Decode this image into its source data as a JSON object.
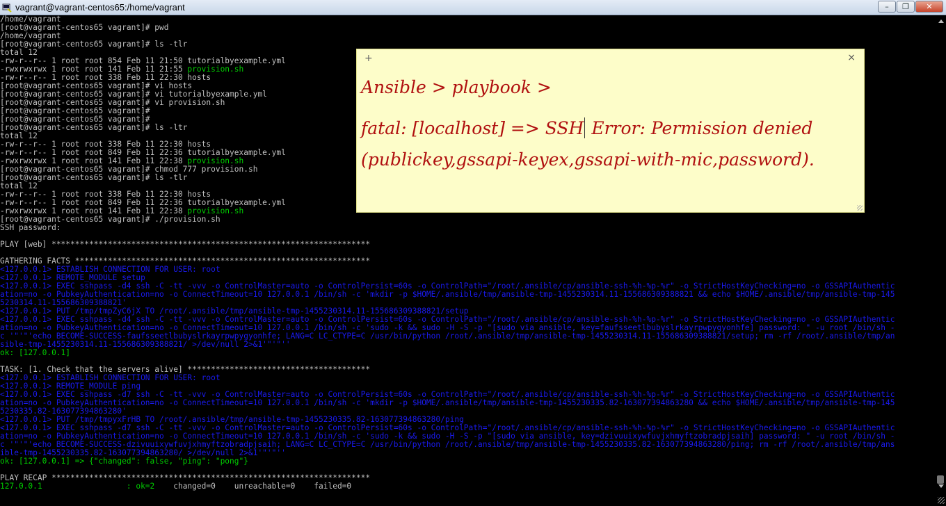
{
  "window": {
    "title": "vagrant@vagrant-centos65:/home/vagrant",
    "minimize": "–",
    "maximize": "❐",
    "close": "✕"
  },
  "terminal_lines": [
    {
      "t": "/home/vagrant",
      "c": "gray"
    },
    {
      "t": "[root@vagrant-centos65 vagrant]# pwd",
      "c": "gray"
    },
    {
      "t": "/home/vagrant",
      "c": "gray"
    },
    {
      "t": "[root@vagrant-centos65 vagrant]# ls -tlr",
      "c": "gray"
    },
    {
      "t": "total 12",
      "c": "gray"
    },
    {
      "t": "-rw-r--r-- 1 root root 854 Feb 11 21:50 tutorialbyexample.yml",
      "c": "gray"
    },
    {
      "t": "-rwxrwxrwx 1 root root 141 Feb 11 21:55 ",
      "c": "gray",
      "g": "provision.sh"
    },
    {
      "t": "-rw-r--r-- 1 root root 338 Feb 11 22:30 hosts",
      "c": "gray"
    },
    {
      "t": "[root@vagrant-centos65 vagrant]# vi hosts",
      "c": "gray"
    },
    {
      "t": "[root@vagrant-centos65 vagrant]# vi tutorialbyexample.yml",
      "c": "gray"
    },
    {
      "t": "[root@vagrant-centos65 vagrant]# vi provision.sh",
      "c": "gray"
    },
    {
      "t": "[root@vagrant-centos65 vagrant]#",
      "c": "gray"
    },
    {
      "t": "[root@vagrant-centos65 vagrant]#",
      "c": "gray"
    },
    {
      "t": "[root@vagrant-centos65 vagrant]# ls -ltr",
      "c": "gray"
    },
    {
      "t": "total 12",
      "c": "gray"
    },
    {
      "t": "-rw-r--r-- 1 root root 338 Feb 11 22:30 hosts",
      "c": "gray"
    },
    {
      "t": "-rw-r--r-- 1 root root 849 Feb 11 22:36 tutorialbyexample.yml",
      "c": "gray"
    },
    {
      "t": "-rwxrwxrwx 1 root root 141 Feb 11 22:38 ",
      "c": "gray",
      "g": "provision.sh"
    },
    {
      "t": "[root@vagrant-centos65 vagrant]# chmod 777 provision.sh",
      "c": "gray"
    },
    {
      "t": "[root@vagrant-centos65 vagrant]# ls -tlr",
      "c": "gray"
    },
    {
      "t": "total 12",
      "c": "gray"
    },
    {
      "t": "-rw-r--r-- 1 root root 338 Feb 11 22:30 hosts",
      "c": "gray"
    },
    {
      "t": "-rw-r--r-- 1 root root 849 Feb 11 22:36 tutorialbyexample.yml",
      "c": "gray"
    },
    {
      "t": "-rwxrwxrwx 1 root root 141 Feb 11 22:38 ",
      "c": "gray",
      "g": "provision.sh"
    },
    {
      "t": "[root@vagrant-centos65 vagrant]# ./provision.sh",
      "c": "gray"
    },
    {
      "t": "SSH password:",
      "c": "gray"
    },
    {
      "t": "",
      "c": "gray"
    },
    {
      "t": "PLAY [web] ********************************************************************",
      "c": "gray"
    },
    {
      "t": "",
      "c": "gray"
    },
    {
      "t": "GATHERING FACTS ***************************************************************",
      "c": "gray"
    },
    {
      "t": "<127.0.0.1> ESTABLISH CONNECTION FOR USER: root",
      "c": "blue"
    },
    {
      "t": "<127.0.0.1> REMOTE_MODULE setup",
      "c": "blue"
    },
    {
      "t": "<127.0.0.1> EXEC sshpass -d4 ssh -C -tt -vvv -o ControlMaster=auto -o ControlPersist=60s -o ControlPath=\"/root/.ansible/cp/ansible-ssh-%h-%p-%r\" -o StrictHostKeyChecking=no -o GSSAPIAuthentic",
      "c": "blue"
    },
    {
      "t": "ation=no -o PubkeyAuthentication=no -o ConnectTimeout=10 127.0.0.1 /bin/sh -c 'mkdir -p $HOME/.ansible/tmp/ansible-tmp-1455230314.11-155686309388821 && echo $HOME/.ansible/tmp/ansible-tmp-145",
      "c": "blue"
    },
    {
      "t": "5230314.11-155686309388821'",
      "c": "blue"
    },
    {
      "t": "<127.0.0.1> PUT /tmp/tmpZyC6jX TO /root/.ansible/tmp/ansible-tmp-1455230314.11-155686309388821/setup",
      "c": "blue"
    },
    {
      "t": "<127.0.0.1> EXEC sshpass -d4 ssh -C -tt -vvv -o ControlMaster=auto -o ControlPersist=60s -o ControlPath=\"/root/.ansible/cp/ansible-ssh-%h-%p-%r\" -o StrictHostKeyChecking=no -o GSSAPIAuthentic",
      "c": "blue"
    },
    {
      "t": "ation=no -o PubkeyAuthentication=no -o ConnectTimeout=10 127.0.0.1 /bin/sh -c 'sudo -k && sudo -H -S -p \"[sudo via ansible, key=faufsseetlbubyslrkayrpwpygyonhfe] password: \" -u root /bin/sh -",
      "c": "blue"
    },
    {
      "t": "c '\"'\"'echo BECOME-SUCCESS-faufsseetlbubyslrkayrpwpygyonhfe; LANG=C LC_CTYPE=C /usr/bin/python /root/.ansible/tmp/ansible-tmp-1455230314.11-155686309388821/setup; rm -rf /root/.ansible/tmp/an",
      "c": "blue"
    },
    {
      "t": "sible-tmp-1455230314.11-155686309388821/ >/dev/null 2>&1'\"'\"''",
      "c": "blue"
    },
    {
      "t": "ok: [127.0.0.1]",
      "c": "green"
    },
    {
      "t": "",
      "c": "gray"
    },
    {
      "t": "TASK: [1. Check that the servers alive] ***************************************",
      "c": "gray"
    },
    {
      "t": "<127.0.0.1> ESTABLISH CONNECTION FOR USER: root",
      "c": "blue"
    },
    {
      "t": "<127.0.0.1> REMOTE_MODULE ping",
      "c": "blue"
    },
    {
      "t": "<127.0.0.1> EXEC sshpass -d7 ssh -C -tt -vvv -o ControlMaster=auto -o ControlPersist=60s -o ControlPath=\"/root/.ansible/cp/ansible-ssh-%h-%p-%r\" -o StrictHostKeyChecking=no -o GSSAPIAuthentic",
      "c": "blue"
    },
    {
      "t": "ation=no -o PubkeyAuthentication=no -o ConnectTimeout=10 127.0.0.1 /bin/sh -c 'mkdir -p $HOME/.ansible/tmp/ansible-tmp-1455230335.82-163077394863280 && echo $HOME/.ansible/tmp/ansible-tmp-145",
      "c": "blue"
    },
    {
      "t": "5230335.82-163077394863280'",
      "c": "blue"
    },
    {
      "t": "<127.0.0.1> PUT /tmp/tmpyxFrHB TO /root/.ansible/tmp/ansible-tmp-1455230335.82-163077394863280/ping",
      "c": "blue"
    },
    {
      "t": "<127.0.0.1> EXEC sshpass -d7 ssh -C -tt -vvv -o ControlMaster=auto -o ControlPersist=60s -o ControlPath=\"/root/.ansible/cp/ansible-ssh-%h-%p-%r\" -o StrictHostKeyChecking=no -o GSSAPIAuthentic",
      "c": "blue"
    },
    {
      "t": "ation=no -o PubkeyAuthentication=no -o ConnectTimeout=10 127.0.0.1 /bin/sh -c 'sudo -k && sudo -H -S -p \"[sudo via ansible, key=dzivuuixywfuvjxhmyftzobradpjsaih] password: \" -u root /bin/sh -",
      "c": "blue"
    },
    {
      "t": "c '\"'\"'echo BECOME-SUCCESS-dzivuuixywfuvjxhmyftzobradpjsaih; LANG=C LC_CTYPE=C /usr/bin/python /root/.ansible/tmp/ansible-tmp-1455230335.82-163077394863280/ping; rm -rf /root/.ansible/tmp/ans",
      "c": "blue"
    },
    {
      "t": "ible-tmp-1455230335.82-163077394863280/ >/dev/null 2>&1'\"'\"''",
      "c": "blue"
    },
    {
      "t": "ok: [127.0.0.1] => {\"changed\": false, \"ping\": \"pong\"}",
      "c": "green"
    },
    {
      "t": "",
      "c": "gray"
    },
    {
      "t": "PLAY RECAP ********************************************************************",
      "c": "gray"
    },
    {
      "t": "127.0.0.1                  : ",
      "c": "green",
      "g2": "ok=2",
      "rest": "    changed=0    unreachable=0    failed=0"
    }
  ],
  "sticky_note": {
    "add_label": "+",
    "close_label": "×",
    "line1": "Ansible > playbook >",
    "line2_pre": "fatal: [localhost] => SSH",
    "line2_post": " Error: Permission denied",
    "line3": "(publickey,gssapi-keyex,gssapi-with-mic,password)."
  },
  "colors": {
    "terminal_bg": "#000000",
    "text_gray": "#c0c0c0",
    "text_green": "#00cd00",
    "text_blue": "#1a1aee",
    "note_bg": "#fdfdc9",
    "note_text": "#b01010"
  }
}
